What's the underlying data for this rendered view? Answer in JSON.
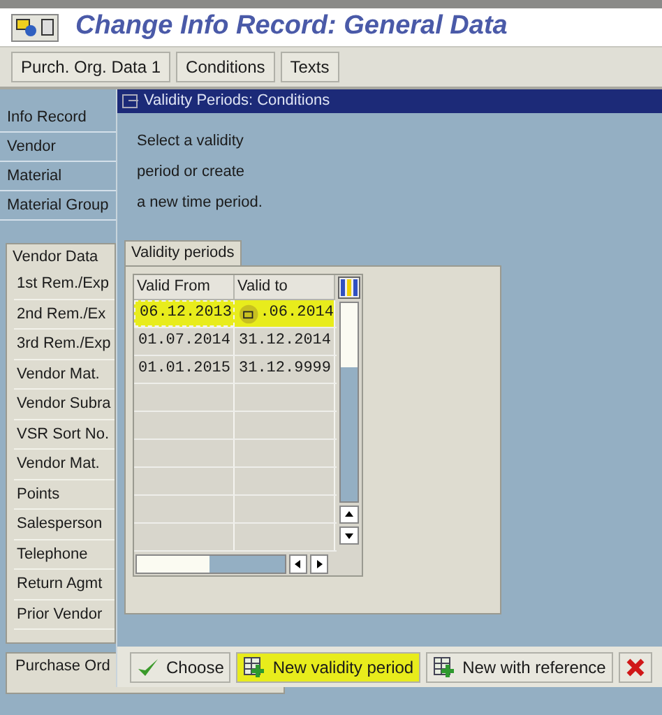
{
  "window": {
    "title": "Change Info Record: General Data"
  },
  "toolbar_buttons": [
    "Purch. Org. Data 1",
    "Conditions",
    "Texts"
  ],
  "header_fields": [
    "Info Record",
    "Vendor",
    "Material",
    "Material Group"
  ],
  "vendor_data": {
    "title": "Vendor Data",
    "items": [
      "1st Rem./Exp",
      "2nd Rem./Ex",
      "3rd Rem./Exp",
      "Vendor Mat.",
      "Vendor Subra",
      "VSR Sort No.",
      "Vendor Mat.",
      "Points",
      "Salesperson",
      "Telephone",
      "Return Agmt",
      "Prior Vendor"
    ]
  },
  "purchase_order_section": {
    "title": "Purchase Ord"
  },
  "dialog": {
    "title": "Validity Periods: Conditions",
    "instructions": [
      "Select a validity",
      "period or create",
      "a new time period."
    ],
    "group_title": "Validity periods",
    "table": {
      "columns": [
        "Valid From",
        "Valid to"
      ],
      "rows": [
        {
          "cells": [
            "06.12.2013",
            ".06.2014"
          ],
          "highlighted": true,
          "cursor": true
        },
        {
          "cells": [
            "01.07.2014",
            "31.12.2014"
          ],
          "highlighted": false,
          "cursor": false
        },
        {
          "cells": [
            "01.01.2015",
            "31.12.9999"
          ],
          "highlighted": false,
          "cursor": false
        }
      ]
    },
    "buttons": [
      {
        "kind": "choose",
        "label": "Choose",
        "highlighted": false
      },
      {
        "kind": "new",
        "label": "New validity period",
        "highlighted": true
      },
      {
        "kind": "reference",
        "label": "New with reference",
        "highlighted": false
      },
      {
        "kind": "cancel",
        "highlighted": false
      }
    ]
  }
}
